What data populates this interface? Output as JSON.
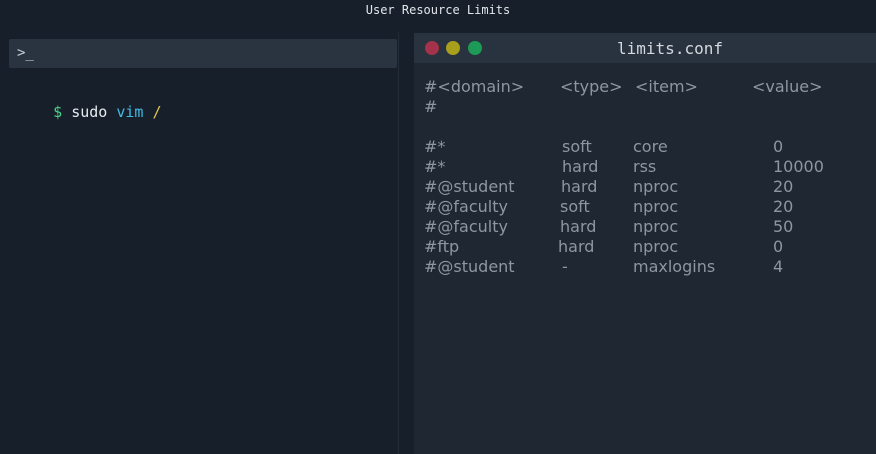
{
  "window": {
    "title": "User Resource Limits"
  },
  "terminal": {
    "prompt_icon": ">_",
    "command": {
      "dollar": "$",
      "sudo": "sudo",
      "vim": "vim",
      "path": "/"
    }
  },
  "editor": {
    "filename": "limits.conf",
    "header_row": {
      "domain": "#<domain>",
      "type": "<type>",
      "item": "<item>",
      "value": "<value>"
    },
    "separator": "#",
    "rows": [
      {
        "domain": "#*",
        "type": "soft",
        "item": "core",
        "value": "0"
      },
      {
        "domain": "#*",
        "type": "hard",
        "item": "rss",
        "value": "10000"
      },
      {
        "domain": "#@student",
        "type": "hard",
        "item": "nproc",
        "value": "20"
      },
      {
        "domain": "#@faculty",
        "type": "soft",
        "item": "nproc",
        "value": "20"
      },
      {
        "domain": "#@faculty",
        "type": "hard",
        "item": "nproc",
        "value": "50"
      },
      {
        "domain": "#ftp",
        "type": "hard",
        "item": "nproc",
        "value": "0"
      },
      {
        "domain": "#@student",
        "type": "-",
        "item": "maxlogins",
        "value": "4"
      }
    ]
  },
  "colors": {
    "background": "#17202a",
    "prompt_dollar": "#4fd08a",
    "vim_keyword": "#43b9e6",
    "path": "#e0c74f",
    "traffic_red": "#a3324a",
    "traffic_yellow": "#a89f1c",
    "traffic_green": "#1d9a55"
  }
}
